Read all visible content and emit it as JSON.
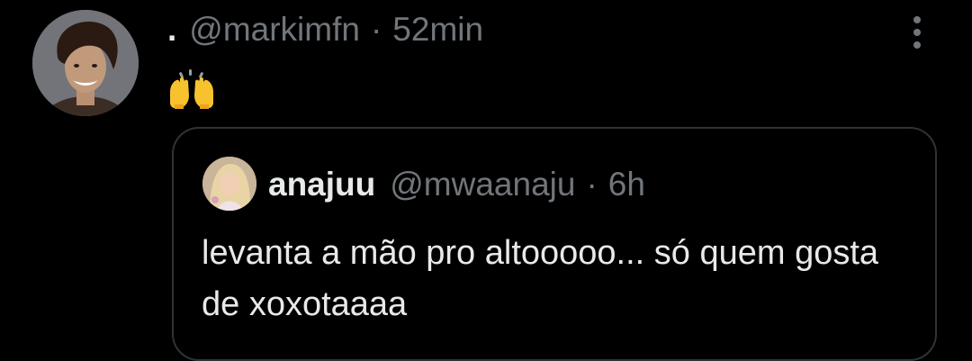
{
  "tweet": {
    "display_name": ".",
    "handle": "@markimfn",
    "separator": "·",
    "time": "52min",
    "emoji": "raising-hands",
    "more_icon": "more-vertical-icon"
  },
  "quoted_tweet": {
    "display_name": "anajuu",
    "handle": "@mwaanaju",
    "separator": "·",
    "time": "6h",
    "text": "levanta a mão pro altooooo... só quem gosta de xoxotaaaa"
  },
  "colors": {
    "background": "#000000",
    "primary_text": "#e7e9ea",
    "secondary_text": "#71767b",
    "border": "#2f3336",
    "emoji": "#f7c22d"
  }
}
